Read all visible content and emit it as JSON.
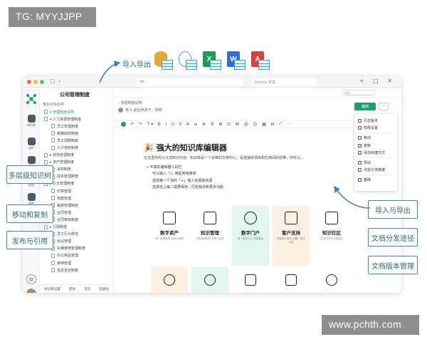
{
  "watermarks": {
    "top_left": "TG: MYYJJPP",
    "bottom_right": "www.pchth.com"
  },
  "callouts": {
    "export": "导入导出",
    "multi_level": "多层级知识树",
    "move_copy": "移动和复制",
    "publish_ref": "发布与引用",
    "import_export": "导入与导出",
    "share": "文档分发途径",
    "version": "文档版本管理"
  },
  "file_icons": [
    "database-file-icon",
    "web-file-icon",
    "excel-file-icon",
    "word-file-icon",
    "pdf-file-icon"
  ],
  "file_icon_letters": {
    "excel": "X",
    "word": "W",
    "pdf": "A"
  },
  "titlebar": {
    "tab_a": "AB",
    "tab_b": "Palette 管理",
    "right": "+ □ ✕"
  },
  "rail": {
    "items": [
      "知识库",
      "协作",
      "模板",
      "应用",
      "组件"
    ]
  },
  "sidebar": {
    "title": "公司管理制度",
    "subtitle": "某知识库名称",
    "items": [
      "▾ 管理制度说明",
      "▾ 人力资源管理制度",
      "员工管理制度",
      "薪酬绩效制度",
      "员工招聘制度",
      "人才培养制度",
      "▸ 财务管理制度",
      "▸ 资产管理制度",
      "采购制度",
      "成本管理制度",
      "▸ 公文管理制度",
      "印章管理",
      "档案管理",
      "差旅管理制度",
      "合同管理",
      "合同审批制度",
      "▸ 行政制度",
      "员工行为规范",
      "会议管理",
      "车辆使用管理制度",
      "办公用品管理",
      "接待管理",
      "信息安全制度"
    ],
    "footer": [
      "知识库设置",
      "回收",
      "首页",
      "回收站"
    ]
  },
  "main": {
    "search_placeholder": "搜索",
    "breadcrumb": "›  管理制度说明",
    "author": "李江 最后修改于：刚刚",
    "edit_button": "编辑",
    "more_button": "···",
    "toolbar": [
      "↶",
      "↷",
      "T ▾",
      "B",
      "I",
      "U",
      "S",
      "A",
      "≡",
      "≣",
      "☰",
      "⊞",
      "⊡",
      "⌘",
      "@",
      "☺",
      "▦",
      "⊟",
      "⤢",
      "···"
    ]
  },
  "doc": {
    "title": "强大的知识库编辑器",
    "sparkle": "🎉",
    "intro": "在这里你可以沉淀知识内容、知识库是一个多维的文档中心，是连接资源库和应用间的纽带，你可以。。",
    "bullets": [
      "• 丰富的编辑器工具栏",
      "可以输入「/」唤起常用菜单",
      "选择第一个块的「+」插入资源库资源",
      "选择完上每二需要保存，历史版本和更多功能"
    ],
    "cards": [
      {
        "label": "数字资产",
        "desc": "统一管理各类\n文档与资源"
      },
      {
        "label": "知识管理",
        "desc": "沉淀组织知识\n共享与复用"
      },
      {
        "label": "数字门户",
        "desc": "统一信息入口\n快速获取"
      },
      {
        "label": "客户支持",
        "desc": "帮助客户解决\n问题、常见问答"
      },
      {
        "label": "知识社区",
        "desc": "交流与分享\n共同成长"
      }
    ]
  },
  "menu": {
    "items": [
      "历史版本",
      "权限设置",
      "移动",
      "复制",
      "添加快捷方式",
      "导出",
      "内容分享链接",
      "删除"
    ]
  },
  "colors": {
    "brand": "#1f9d6b",
    "callout": "#3f8f8a",
    "watermark": "#8e8e8e"
  }
}
